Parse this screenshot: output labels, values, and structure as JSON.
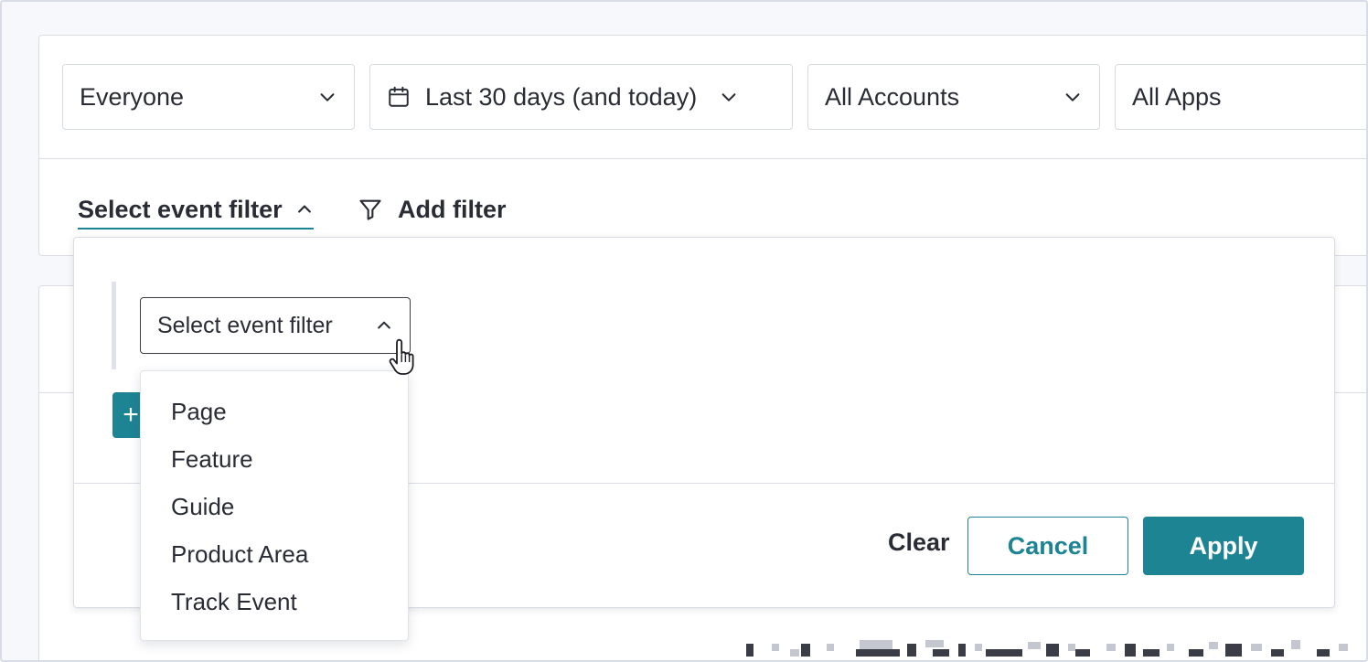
{
  "filters": {
    "segment": "Everyone",
    "date_range": "Last 30 days (and today)",
    "accounts": "All Accounts",
    "apps": "All Apps"
  },
  "tabs": {
    "event_filter": "Select event filter",
    "add_filter": "Add filter"
  },
  "panel": {
    "select_placeholder": "Select event filter",
    "add_row_symbol": "+",
    "clear_label": "Clear",
    "cancel_label": "Cancel",
    "apply_label": "Apply"
  },
  "menu": {
    "items": [
      "Page",
      "Feature",
      "Guide",
      "Product Area",
      "Track Event"
    ]
  },
  "colors": {
    "accent": "#1d8494",
    "text": "#2a2c35",
    "border": "#d5d9e1"
  },
  "icons": {
    "chevron": "chevron-down-icon",
    "calendar": "calendar-icon",
    "funnel": "funnel-icon",
    "cursor": "hand-pointer-icon"
  }
}
